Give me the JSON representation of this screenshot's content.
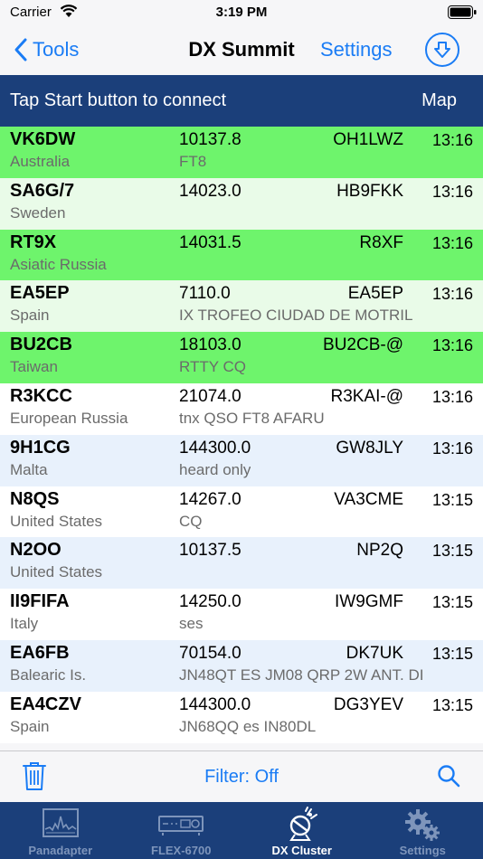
{
  "status_bar": {
    "carrier": "Carrier",
    "time": "3:19 PM"
  },
  "nav": {
    "back_label": "Tools",
    "title": "DX Summit",
    "settings_label": "Settings"
  },
  "connect_bar": {
    "message": "Tap Start button to connect",
    "map_label": "Map"
  },
  "colors": {
    "accent": "#1a7cf5",
    "navy": "#1b3f7a",
    "green_bright": "#6ef46c",
    "green_pale": "#e9fbe8",
    "blue_pale": "#e8f1fc",
    "white": "#ffffff"
  },
  "spots": [
    {
      "call": "VK6DW",
      "country": "Australia",
      "freq": "10137.8",
      "spotter": "OH1LWZ",
      "comment": "FT8",
      "time": "13:16",
      "bg": "#6ef46c"
    },
    {
      "call": "SA6G/7",
      "country": "Sweden",
      "freq": "14023.0",
      "spotter": "HB9FKK",
      "comment": "",
      "time": "13:16",
      "bg": "#e9fbe8"
    },
    {
      "call": "RT9X",
      "country": "Asiatic Russia",
      "freq": "14031.5",
      "spotter": "R8XF",
      "comment": "",
      "time": "13:16",
      "bg": "#6ef46c"
    },
    {
      "call": "EA5EP",
      "country": "Spain",
      "freq": "7110.0",
      "spotter": "EA5EP",
      "comment": "IX TROFEO CIUDAD DE MOTRIL",
      "time": "13:16",
      "bg": "#e9fbe8"
    },
    {
      "call": "BU2CB",
      "country": "Taiwan",
      "freq": "18103.0",
      "spotter": "BU2CB-@",
      "comment": "RTTY CQ",
      "time": "13:16",
      "bg": "#6ef46c"
    },
    {
      "call": "R3KCC",
      "country": "European Russia",
      "freq": "21074.0",
      "spotter": "R3KAI-@",
      "comment": "tnx QSO FT8 AFARU",
      "time": "13:16",
      "bg": "#ffffff"
    },
    {
      "call": "9H1CG",
      "country": "Malta",
      "freq": "144300.0",
      "spotter": "GW8JLY",
      "comment": "heard only",
      "time": "13:16",
      "bg": "#e8f1fc"
    },
    {
      "call": "N8QS",
      "country": "United States",
      "freq": "14267.0",
      "spotter": "VA3CME",
      "comment": "CQ",
      "time": "13:15",
      "bg": "#ffffff"
    },
    {
      "call": "N2OO",
      "country": "United States",
      "freq": "10137.5",
      "spotter": "NP2Q",
      "comment": "",
      "time": "13:15",
      "bg": "#e8f1fc"
    },
    {
      "call": "II9FIFA",
      "country": "Italy",
      "freq": "14250.0",
      "spotter": "IW9GMF",
      "comment": "ses",
      "time": "13:15",
      "bg": "#ffffff"
    },
    {
      "call": "EA6FB",
      "country": "Balearic Is.",
      "freq": "70154.0",
      "spotter": "DK7UK",
      "comment": "JN48QT ES JM08 QRP 2W ANT. DI",
      "time": "13:15",
      "bg": "#e8f1fc"
    },
    {
      "call": "EA4CZV",
      "country": "Spain",
      "freq": "144300.0",
      "spotter": "DG3YEV",
      "comment": "JN68QQ es IN80DL",
      "time": "13:15",
      "bg": "#ffffff"
    }
  ],
  "toolbar": {
    "filter_label": "Filter: Off"
  },
  "tabs": [
    {
      "label": "Panadapter",
      "icon": "panadapter-icon",
      "active": false
    },
    {
      "label": "FLEX-6700",
      "icon": "radio-icon",
      "active": false
    },
    {
      "label": "DX Cluster",
      "icon": "satellite-icon",
      "active": true
    },
    {
      "label": "Settings",
      "icon": "gear-icon",
      "active": false
    }
  ]
}
